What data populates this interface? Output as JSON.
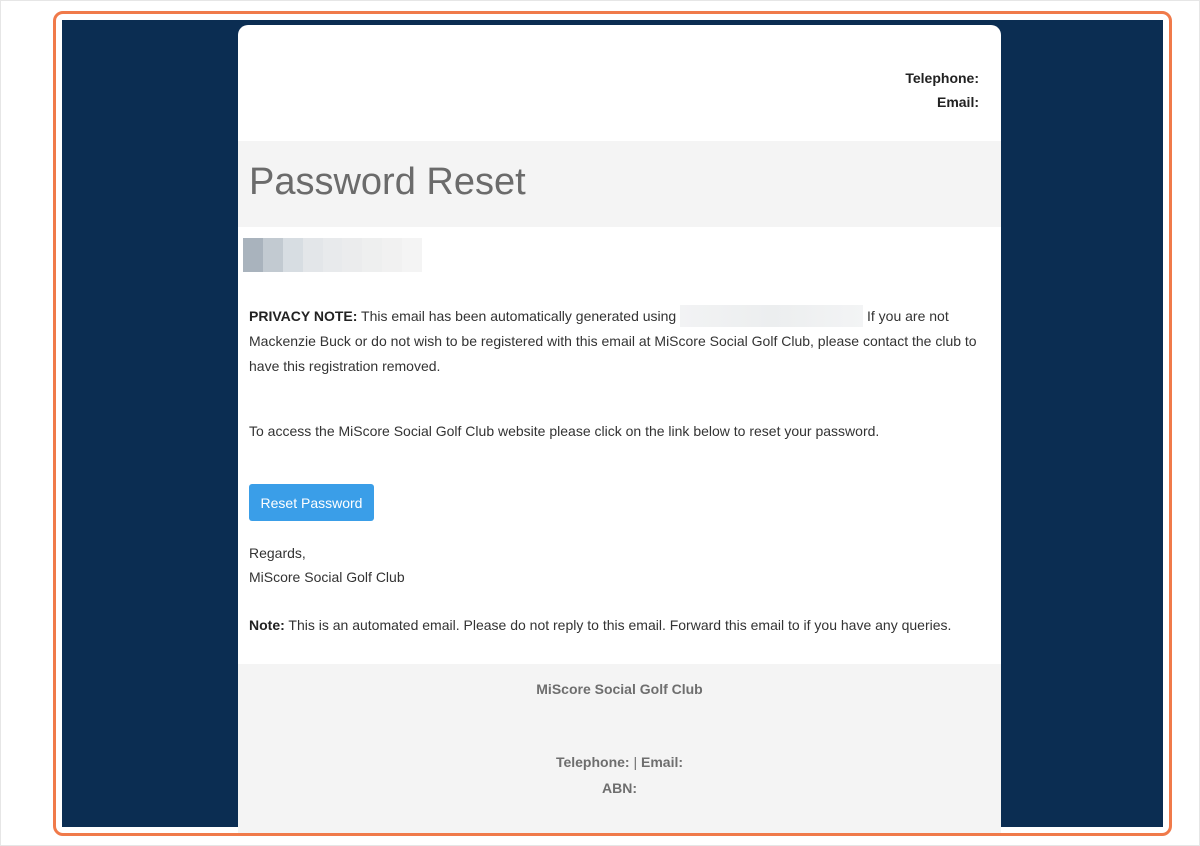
{
  "header": {
    "telephone_label": "Telephone:",
    "email_label": "Email:"
  },
  "title": "Password Reset",
  "privacy": {
    "label": "PRIVACY NOTE:",
    "text_before": "This email has been automatically generated using",
    "text_after": "If you are not Mackenzie Buck or do not wish to be registered with this email at MiScore Social Golf Club, please contact the club to have this registration removed."
  },
  "access_text": "To access the MiScore Social Golf Club website please click on the link below to reset your password.",
  "reset_button_label": "Reset Password",
  "regards": {
    "line1": "Regards,",
    "line2": "MiScore Social Golf Club"
  },
  "note": {
    "label": "Note:",
    "text": "This is an automated email. Please do not reply to this email. Forward this email to if you have any queries."
  },
  "footer": {
    "club_name": "MiScore Social Golf Club",
    "telephone_label": "Telephone:",
    "separator": "|",
    "email_label": "Email:",
    "abn_label": "ABN:"
  },
  "colors": {
    "navy_background": "#0b2d52",
    "highlight_border": "#f07a4a",
    "button": "#3a9ee8",
    "band": "#f4f4f4"
  }
}
